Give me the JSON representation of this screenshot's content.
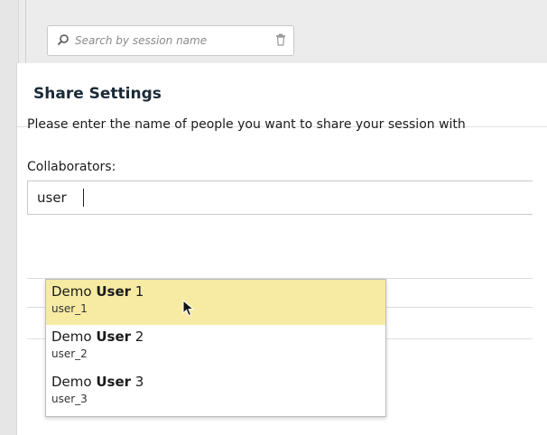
{
  "search": {
    "placeholder": "Search by session name"
  },
  "dialog": {
    "title": "Share Settings",
    "instructions": "Please enter the name of people you want to share your session with",
    "collaborators_label": "Collaborators:",
    "collaborators_value": "user"
  },
  "suggestions": [
    {
      "name_plain": "Demo ",
      "name_bold": "User",
      "name_suffix": " 1",
      "id": "user_1",
      "highlighted": true
    },
    {
      "name_plain": "Demo ",
      "name_bold": "User",
      "name_suffix": " 2",
      "id": "user_2",
      "highlighted": false
    },
    {
      "name_plain": "Demo ",
      "name_bold": "User",
      "name_suffix": " 3",
      "id": "user_3",
      "highlighted": false
    }
  ],
  "colors": {
    "highlight": "#f7eba4",
    "title": "#1b2a38"
  },
  "icons": [
    "search-icon",
    "trash-icon",
    "mouse-cursor-icon"
  ]
}
